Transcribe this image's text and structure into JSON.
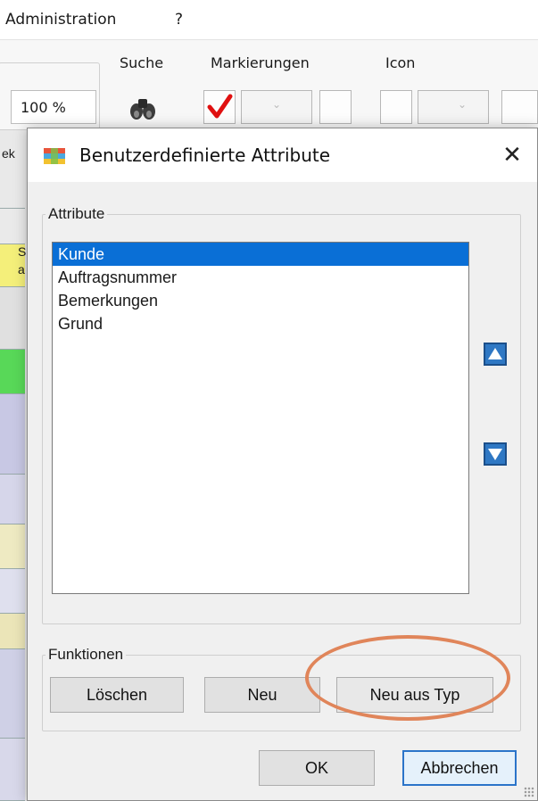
{
  "menubar": {
    "items": [
      "Administration",
      "?"
    ]
  },
  "ribbon": {
    "zoom_value": "100 %",
    "groups": {
      "search": "Suche",
      "markings": "Markierungen",
      "icon": "Icon"
    }
  },
  "background_strip": {
    "fragments": [
      "ek",
      "S",
      "a"
    ]
  },
  "dialog": {
    "title": "Benutzerdefinierte Attribute",
    "close_glyph": "✕",
    "attributes_group_label": "Attribute",
    "attributes": [
      {
        "label": "Kunde",
        "selected": true
      },
      {
        "label": "Auftragsnummer",
        "selected": false
      },
      {
        "label": "Bemerkungen",
        "selected": false
      },
      {
        "label": "Grund",
        "selected": false
      }
    ],
    "move_up_icon": "arrow-up-icon",
    "move_down_icon": "arrow-down-icon",
    "functions_group_label": "Funktionen",
    "buttons": {
      "delete": "Löschen",
      "new": "Neu",
      "new_from_type": "Neu aus Typ",
      "ok": "OK",
      "cancel": "Abbrechen"
    }
  },
  "colors": {
    "selection": "#0a6fd6",
    "highlight_ellipse": "#e0855a",
    "check_mark": "#e01010",
    "arrow_button": "#2f78c4"
  }
}
